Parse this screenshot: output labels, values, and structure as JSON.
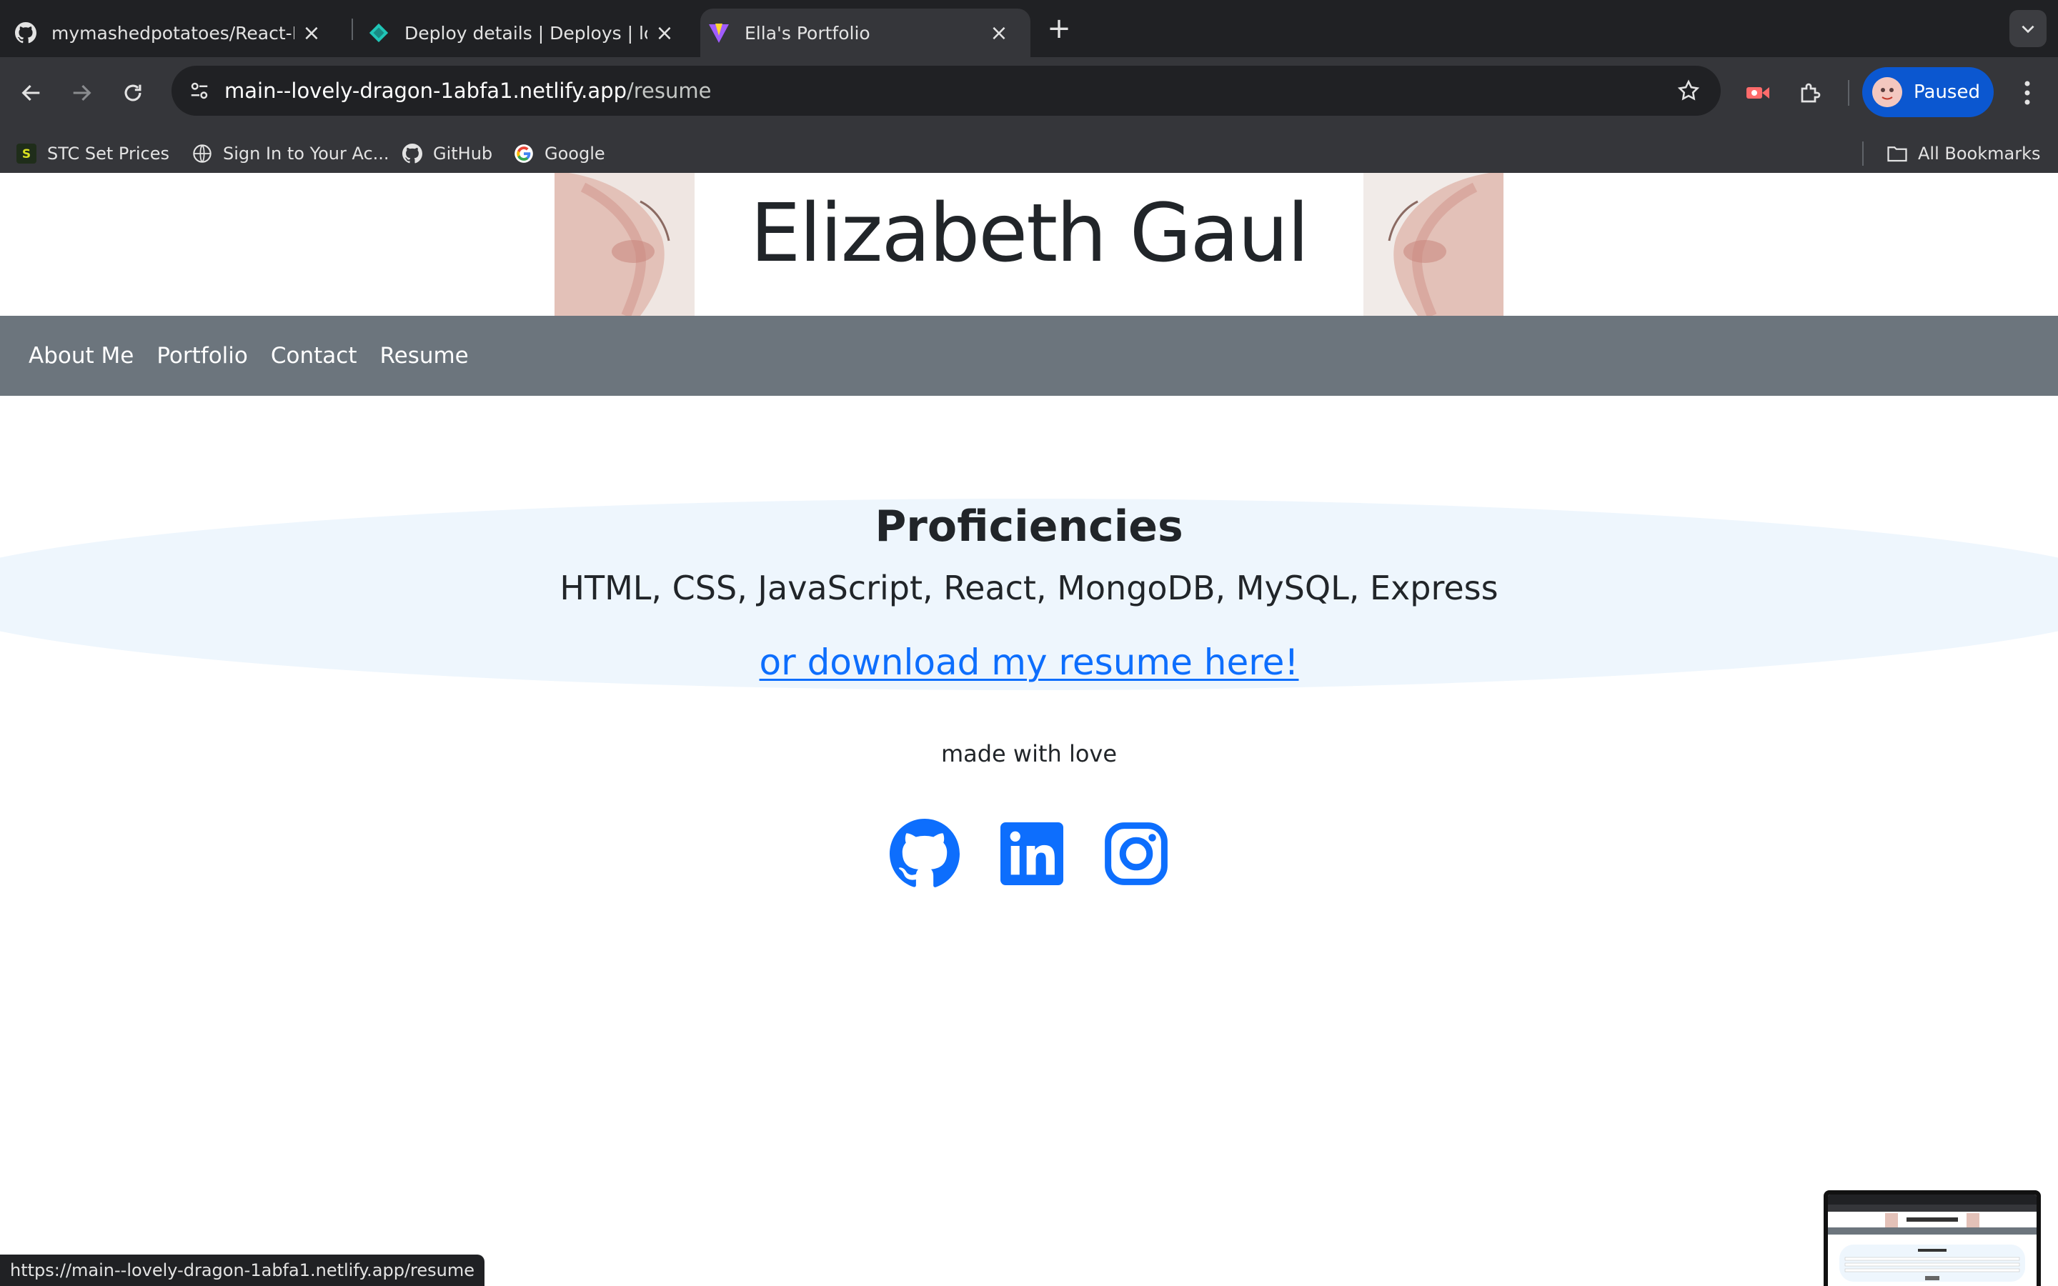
{
  "browser": {
    "tabs": [
      {
        "title": "mymashedpotatoes/React-Po",
        "icon": "github-icon"
      },
      {
        "title": "Deploy details | Deploys | love",
        "icon": "netlify-icon"
      },
      {
        "title": "Ella's Portfolio",
        "icon": "vite-icon"
      }
    ],
    "address": {
      "host": "main--lovely-dragon-1abfa1.netlify.app",
      "path": "/resume"
    },
    "profile_label": "Paused",
    "bookmarks": [
      {
        "label": "STC Set Prices",
        "icon": "s-icon"
      },
      {
        "label": "Sign In to Your Ac...",
        "icon": "globe-icon"
      },
      {
        "label": "GitHub",
        "icon": "github-icon"
      },
      {
        "label": "Google",
        "icon": "google-icon"
      }
    ],
    "all_bookmarks_label": "All Bookmarks",
    "status_url": "https://main--lovely-dragon-1abfa1.netlify.app/resume"
  },
  "page": {
    "header_title": "Elizabeth Gaul",
    "nav": [
      "About Me",
      "Portfolio",
      "Contact",
      "Resume"
    ],
    "proficiencies_title": "Proficiencies",
    "proficiencies_list": "HTML, CSS, JavaScript, React, MongoDB, MySQL, Express",
    "resume_link": "or download my resume here!",
    "footer_text": "made with love",
    "socials": [
      "github-icon",
      "linkedin-icon",
      "instagram-icon"
    ]
  },
  "colors": {
    "accent_link": "#0d6efd",
    "nav_bg": "#6c757d",
    "section_bg": "#eef6fd",
    "chrome_dark": "#202124",
    "profile_pill": "#0b57d0"
  }
}
